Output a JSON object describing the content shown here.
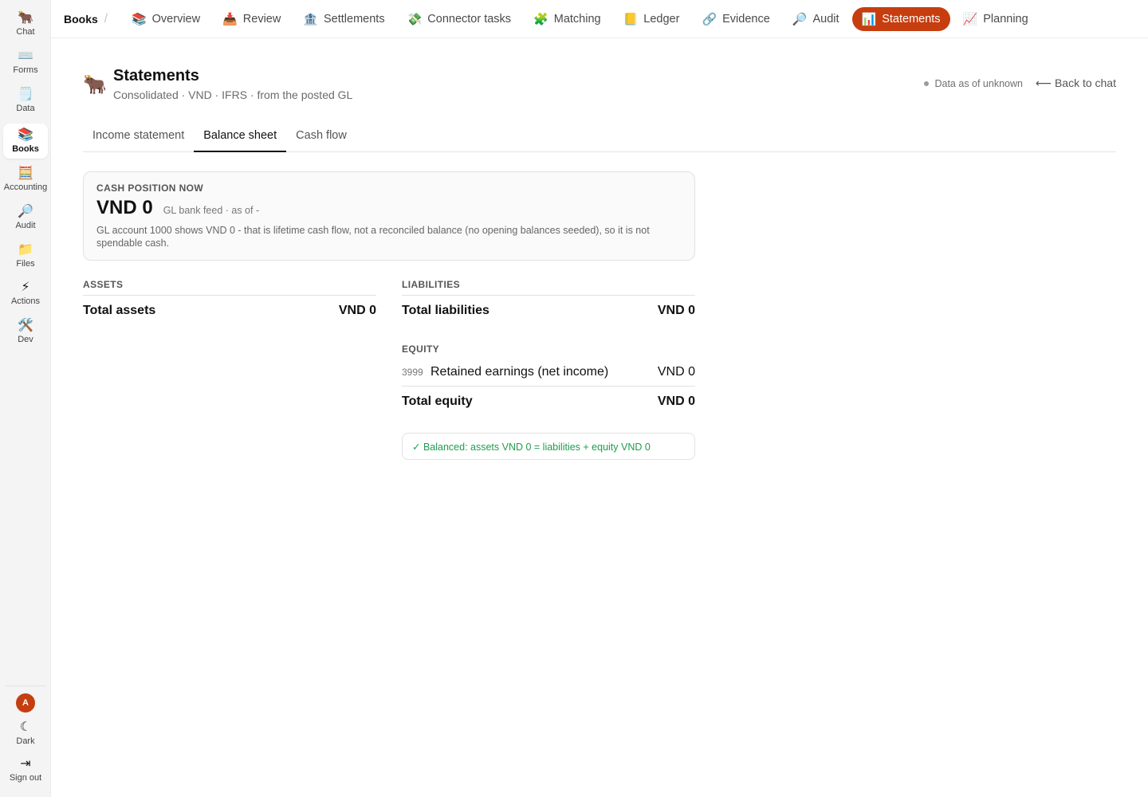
{
  "rail": {
    "items": [
      {
        "icon": "🐂",
        "label": "Chat"
      },
      {
        "icon": "⌨️",
        "label": "Forms"
      },
      {
        "icon": "🗒️",
        "label": "Data"
      },
      {
        "icon": "📚",
        "label": "Books"
      },
      {
        "icon": "🧮",
        "label": "Accounting"
      },
      {
        "icon": "🔎",
        "label": "Audit"
      },
      {
        "icon": "📁",
        "label": "Files"
      },
      {
        "icon": "⚡",
        "label": "Actions"
      },
      {
        "icon": "🛠️",
        "label": "Dev"
      }
    ],
    "active": "Books",
    "avatar": "A",
    "dark": {
      "icon": "☾",
      "label": "Dark"
    },
    "signout": {
      "icon": "⇥",
      "label": "Sign out"
    }
  },
  "topnav": {
    "crumb": "Books",
    "crumb_sep": "/",
    "tabs": [
      {
        "icon": "📚",
        "label": "Overview"
      },
      {
        "icon": "📥",
        "label": "Review"
      },
      {
        "icon": "🏦",
        "label": "Settlements"
      },
      {
        "icon": "💸",
        "label": "Connector tasks"
      },
      {
        "icon": "🧩",
        "label": "Matching"
      },
      {
        "icon": "📒",
        "label": "Ledger"
      },
      {
        "icon": "🔗",
        "label": "Evidence"
      },
      {
        "icon": "🔎",
        "label": "Audit"
      },
      {
        "icon": "📊",
        "label": "Statements"
      },
      {
        "icon": "📈",
        "label": "Planning"
      }
    ],
    "active": "Statements"
  },
  "header": {
    "logo": "🐂",
    "title": "Statements",
    "subtitle": "Consolidated · VND · IFRS · from the posted GL",
    "status": "Data as of unknown",
    "back": "⟵ Back to chat"
  },
  "tabs": {
    "items": [
      "Income statement",
      "Balance sheet",
      "Cash flow"
    ],
    "active": "Balance sheet"
  },
  "cash": {
    "label": "CASH POSITION NOW",
    "amount": "VND 0",
    "meta": "GL bank feed · as of -",
    "note": "GL account 1000 shows VND 0 - that is lifetime cash flow, not a reconciled balance (no opening balances seeded), so it is not spendable cash."
  },
  "assets": {
    "head": "ASSETS",
    "total_label": "Total assets",
    "total_value": "VND 0"
  },
  "liabilities": {
    "head": "LIABILITIES",
    "total_label": "Total liabilities",
    "total_value": "VND 0"
  },
  "equity": {
    "head": "EQUITY",
    "lines": [
      {
        "code": "3999",
        "name": "Retained earnings (net income)",
        "value": "VND 0"
      }
    ],
    "total_label": "Total equity",
    "total_value": "VND 0"
  },
  "balanced": "✓ Balanced: assets VND 0 = liabilities + equity VND 0",
  "colors": {
    "accent": "#c63d0f",
    "success": "#1e9e4a"
  }
}
